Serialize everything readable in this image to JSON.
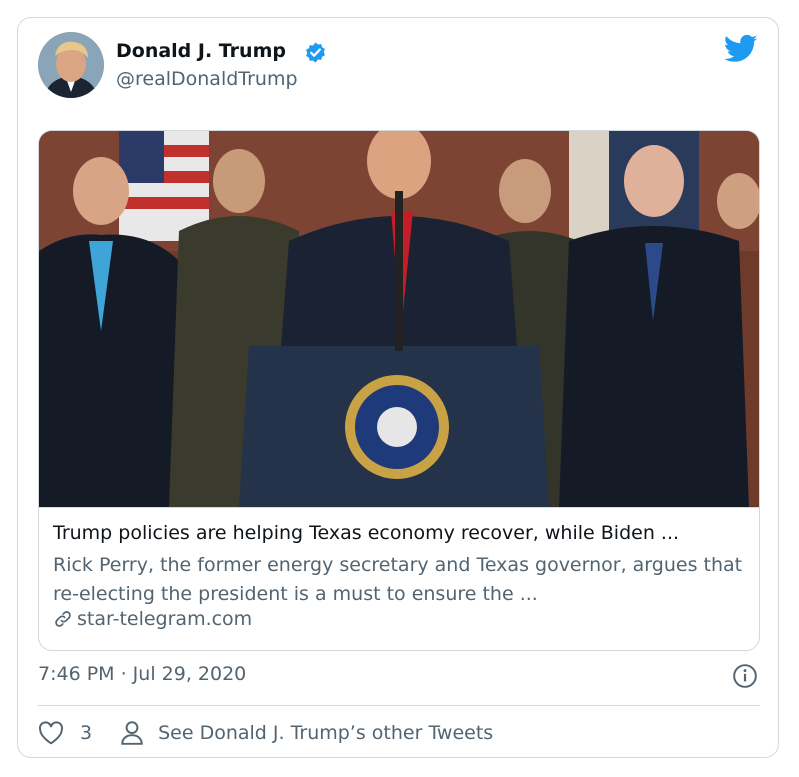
{
  "author": {
    "name": "Donald J. Trump",
    "handle": "@realDonaldTrump"
  },
  "card": {
    "title": "Trump policies are helping Texas economy recover, while Biden ...",
    "description": "Rick Perry, the former energy secretary and Texas governor, argues that re-electing the president is a must to ensure the ...",
    "domain": "star-telegram.com"
  },
  "timestamp": "7:46 PM · Jul 29, 2020",
  "actions": {
    "like_count": "3",
    "other_tweets_label": "See Donald J. Trump’s other Tweets"
  },
  "icons": {
    "verified": "verified-badge-icon",
    "brand": "twitter-bird-icon",
    "link": "link-icon",
    "info": "info-icon",
    "like": "heart-icon",
    "person": "person-icon"
  },
  "colors": {
    "brand_blue": "#1d9bf0",
    "text_primary": "#0f1419",
    "text_secondary": "#536471",
    "border": "#cfd9de"
  }
}
